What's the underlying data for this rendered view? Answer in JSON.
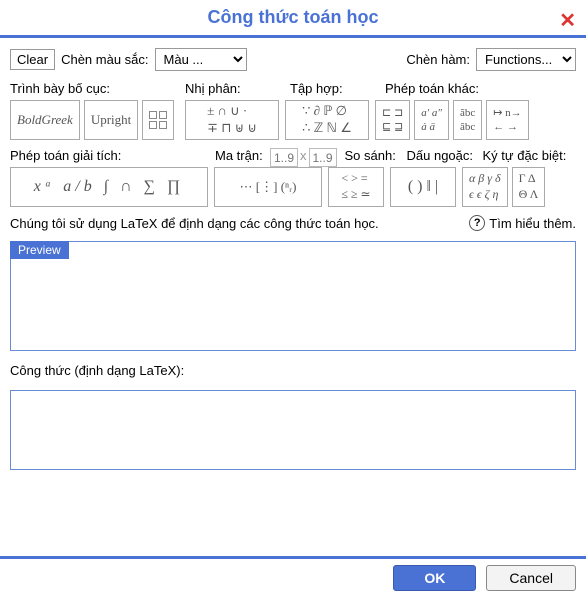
{
  "title": "Công thức toán học",
  "top": {
    "clear": "Clear",
    "insert_color_label": "Chèn màu sắc:",
    "color_placeholder": "Màu ...",
    "insert_func_label": "Chèn hàm:",
    "func_placeholder": "Functions..."
  },
  "sections": {
    "layout": "Trình bày bố cục:",
    "binary": "Nhị phân:",
    "sets": "Tập hợp:",
    "other_ops": "Phép toán khác:",
    "calculus": "Phép toán giải tích:",
    "matrix": "Ma trận:",
    "compare": "So sánh:",
    "brackets": "Dấu ngoặc:",
    "special": "Ký tự đặc biệt:"
  },
  "palettes": {
    "layout1": "BoldGreek",
    "layout2": "Upright",
    "binary": "± ∩ ∪ ·\n∓ ⊓ ⊎ ⊍",
    "sets": "∵ ∂ ℙ ∅\n∴ ℤ ℕ ∠",
    "other1": "⊏ ⊐\n⊑ ⊒",
    "other2": "a′ a″\nȧ ä",
    "other3": "ãbc\nâbc",
    "other4": "↦ n→\n← →",
    "calculus": "xᵃ  a/b  ∫  ∩  ∑  ∏",
    "matrix_content": "⋯  [⋮]  (ⁿᵣ)",
    "compare": "< > =\n≤ ≥ ≃",
    "brackets": "( ) ‖ |",
    "special1": "α β γ δ\nϵ ϵ ζ η",
    "special2": "Γ Δ\nΘ Λ"
  },
  "matrix": {
    "rows": "1..9",
    "x": "x",
    "cols": "1..9"
  },
  "note": "Chúng tôi sử dụng LaTeX để định dạng các công thức toán học.",
  "learn_more": "Tìm hiểu thêm.",
  "preview_label": "Preview",
  "formula_label": "Công thức (định dạng LaTeX):",
  "formula_value": "",
  "buttons": {
    "ok": "OK",
    "cancel": "Cancel"
  }
}
